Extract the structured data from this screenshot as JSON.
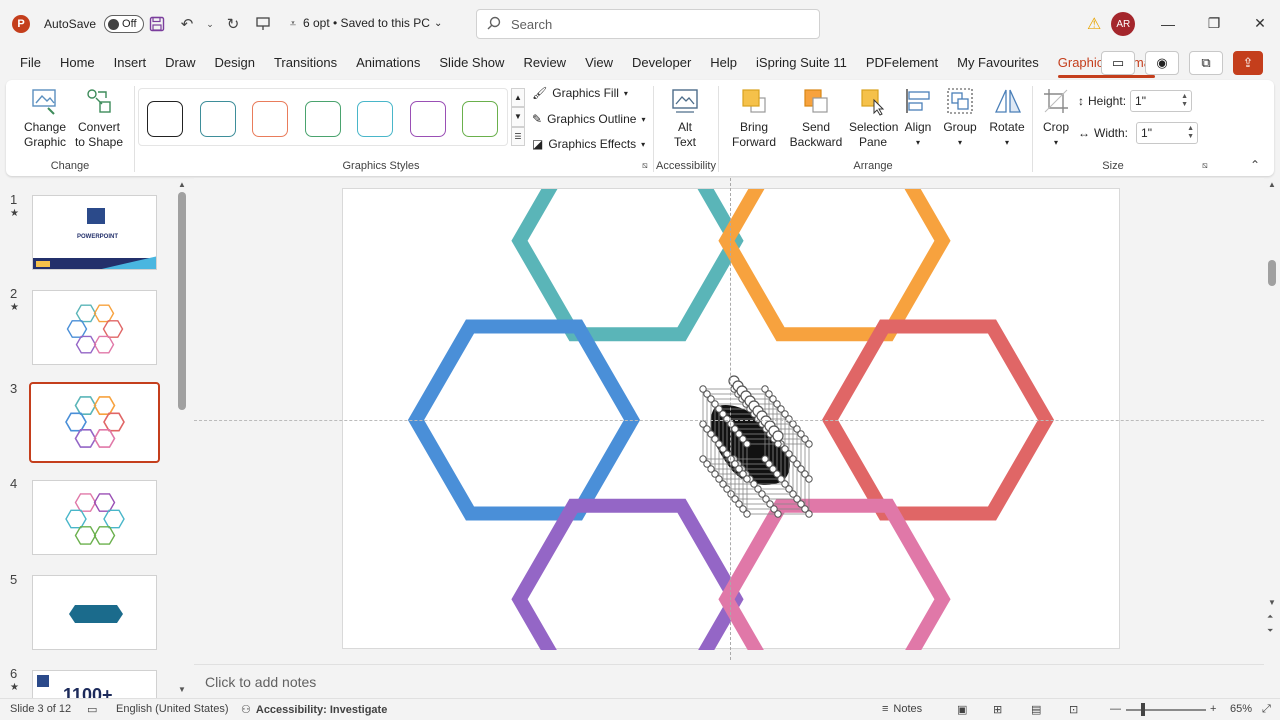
{
  "titlebar": {
    "app_logo": "P",
    "autosave_label": "AutoSave",
    "autosave_state": "Off",
    "doc_title": "6 opt • Saved to this PC",
    "search_placeholder": "Search",
    "user_initials": "AR"
  },
  "menu": {
    "tabs": [
      "File",
      "Home",
      "Insert",
      "Draw",
      "Design",
      "Transitions",
      "Animations",
      "Slide Show",
      "Review",
      "View",
      "Developer",
      "Help",
      "iSpring Suite 11",
      "PDFelement",
      "My Favourites",
      "Graphics Format"
    ],
    "active_tab": "Graphics Format"
  },
  "ribbon": {
    "change": {
      "change_graphic": "Change Graphic",
      "convert_shape": "Convert to Shape",
      "group_label": "Change"
    },
    "styles": {
      "group_label": "Graphics Styles",
      "swatch_colors": [
        "#222222",
        "#3e8e9a",
        "#e97c5b",
        "#4aa36e",
        "#49b6c9",
        "#9a4fb5",
        "#6ab04c"
      ]
    },
    "format": {
      "fill": "Graphics Fill",
      "outline": "Graphics Outline",
      "effects": "Graphics Effects"
    },
    "accessibility": {
      "alt_text": "Alt Text",
      "group_label": "Accessibility"
    },
    "arrange": {
      "bring_forward": "Bring Forward",
      "send_backward": "Send Backward",
      "selection_pane": "Selection Pane",
      "align": "Align",
      "group": "Group",
      "rotate": "Rotate",
      "group_label": "Arrange"
    },
    "size": {
      "crop": "Crop",
      "height_label": "Height:",
      "height_value": "1\"",
      "width_label": "Width:",
      "width_value": "1\"",
      "group_label": "Size"
    }
  },
  "thumbnails": [
    {
      "num": "1",
      "star": "★",
      "caption": "POWERPOINT"
    },
    {
      "num": "2",
      "star": "★"
    },
    {
      "num": "3",
      "star": ""
    },
    {
      "num": "4",
      "star": ""
    },
    {
      "num": "5",
      "star": ""
    },
    {
      "num": "6",
      "star": "★",
      "caption": "1100+"
    }
  ],
  "slide": {
    "hex_colors": {
      "teal": "#5ab5b8",
      "orange": "#f7a23e",
      "blue": "#4a8fd8",
      "red": "#e06666",
      "purple": "#9466c6",
      "pink": "#e078a8"
    }
  },
  "notes_placeholder": "Click to add notes",
  "status": {
    "slide_info": "Slide 3 of 12",
    "language": "English (United States)",
    "accessibility": "Accessibility: Investigate",
    "notes": "Notes",
    "zoom": "65%"
  }
}
